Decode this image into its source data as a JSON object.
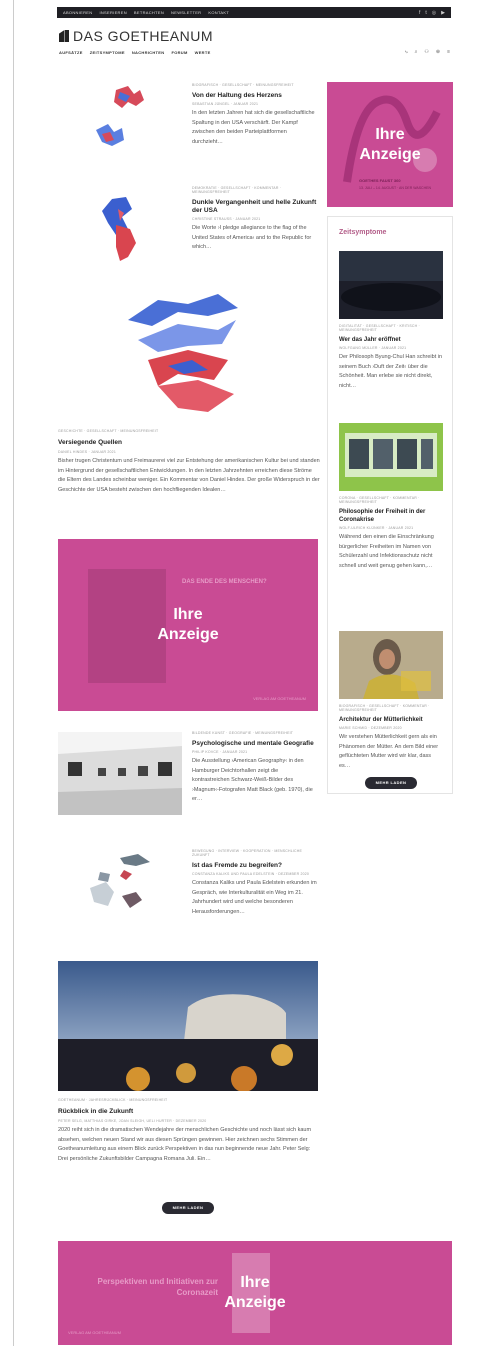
{
  "topbar": {
    "links": [
      "Abonnieren",
      "Inserieren",
      "Betrachten",
      "Newsletter",
      "Kontakt"
    ],
    "social": [
      "f",
      "t",
      "◎",
      "▶"
    ]
  },
  "brand": {
    "name": "DAS GOETHEANUM"
  },
  "nav": {
    "items": [
      "Aufsätze",
      "Zeitsymptome",
      "Nachrichten",
      "Forum",
      "Werte"
    ],
    "icons": [
      "⤷",
      "⌕",
      "⚇",
      "⊕",
      "≡"
    ]
  },
  "posts": [
    {
      "category": "Biografisch · Gesellschaft · Meinungsfreiheit",
      "title": "Von der Haltung des Herzens",
      "meta": "Sebastian Jüngel · Januar 2021",
      "excerpt": "In den letzten Jahren hat sich die gesellschaftliche Spaltung in den USA verschärft. Der Kampf zwischen den beiden Parteiplattformen durchzieht…"
    },
    {
      "category": "Demokratie · Gesellschaft · Kommentar · Meinungsfreiheit",
      "title": "Dunkle Vergangenheit und helle Zukunft der USA",
      "meta": "Christine Strauss · Januar 2021",
      "excerpt": "Die Worte ›I pledge allegiance to the flag of the United States of America‹ and to the Republic for which…"
    },
    {
      "category": "Geschichte · Gesellschaft · Meinungsfreiheit",
      "title": "Versiegende Quellen",
      "meta": "Daniel Hindes · Januar 2021",
      "excerpt": "Bisher trugen Christentum und Freimaurerei viel zur Entstehung der amerikanischen Kultur bei und standen im Hintergrund der gesellschaftlichen Entwicklungen. In den letzten Jahrzehnten erreichen diese Ströme die Eltern des Landes scheinbar weniger. Ein Kommentar von Daniel Hindes. Der große Widerspruch in der Geschichte der USA besteht zwischen den hochfliegenden Idealen…"
    },
    {
      "category": "Bildende Kunst · Geografie · Meinungsfreiheit",
      "title": "Psychologische und mentale Geografie",
      "meta": "Philip Kovce · Januar 2021",
      "excerpt": "Die Ausstellung ›American Geography‹ in den Hamburger Deichtorhallen zeigt die kontrastreichen Schwarz-Weiß-Bilder des ›Magnum‹-Fotografen Matt Black (geb. 1970), die er…"
    },
    {
      "category": "Bewegung · Interview · Kooperation · Menschliche Zukunft",
      "title": "Ist das Fremde zu begreifen?",
      "meta": "Constanza Kaliks und Paula Edelstein · Dezember 2020",
      "excerpt": "Constanza Kaliks und Paula Edelstein erkunden im Gespräch, wie Interkulturalität ein Weg im 21. Jahrhundert wird und welche besonderen Herausforderungen…"
    },
    {
      "category": "Goetheanum · Jahresrückblick · Meinungsfreiheit",
      "title": "Rückblick in die Zukunft",
      "meta": "Peter Selg, Matthias Girke, Joan Sleigh, Ueli Hurter · Dezember 2020",
      "excerpt": "2020 reiht sich in die dramatischen Wendejahre der menschlichen Geschichte und noch lässt sich kaum absehen, welchen neuen Stand wir aus diesen Sprüngen gewinnen. Hier zeichnen sechs Stimmen der Goetheanumleitung aus einem Blick zurück Perspektiven in das nun beginnende neue Jahr. Peter Selg: Drei persönliche Zukunftsbilder Campagna Romana Juli. Ein…"
    }
  ],
  "ads": {
    "label": "Ihre\nAnzeige",
    "mid_title": "DAS ENDE DES MENSCHEN?",
    "mid_footer": "VERLAG AM GOETHEANUM",
    "bottom_title": "Perspektiven und Initiativen zur Coronazeit",
    "bottom_footer": "VERLAG AM GOETHEANUM",
    "side_title": "GOETHES FAUST 360",
    "side_lines": "13. JULI – 14. AUGUST · AN DER WASCHEN"
  },
  "sidebar": {
    "title": "Zeitsymptome",
    "posts": [
      {
        "category": "Digitalität · Gesellschaft · Kritisch · Meinungsfreiheit",
        "title": "Wer das Jahr eröffnet",
        "meta": "Wolfgang Müller · Januar 2021",
        "excerpt": "Der Philosoph Byung-Chul Han schreibt in seinem Buch ›Duft der Zeit‹ über die Schönheit. Man erlebe sie nicht direkt, nicht…"
      },
      {
        "category": "Corona · Gesellschaft · Kommentar · Meinungsfreiheit",
        "title": "Philosophie der Freiheit in der Coronakrise",
        "meta": "Wolf-Ulrich Klünker · Januar 2021",
        "excerpt": "Während den einen die Einschränkung bürgerlicher Freiheiten im Namen von Schülerzahl und Infektionsschutz nicht schnell und weit genug gehen kann,…"
      },
      {
        "category": "Biografisch · Gesellschaft · Kommentar · Meinungsfreiheit",
        "title": "Architektur der Mütterlichkeit",
        "meta": "Marie Schmid · Dezember 2020",
        "excerpt": "Wir verstehen Mütterlichkeit gern als ein Phänomen der Mütter. An dem Bild einer geflüchteten Mutter wird wir klar, dass es…"
      }
    ],
    "more_label": "Mehr laden"
  },
  "more_label": "Mehr laden",
  "colors": {
    "ad_magenta": "#c94b94",
    "accent": "#b35e89",
    "dark": "#2a2a32"
  }
}
